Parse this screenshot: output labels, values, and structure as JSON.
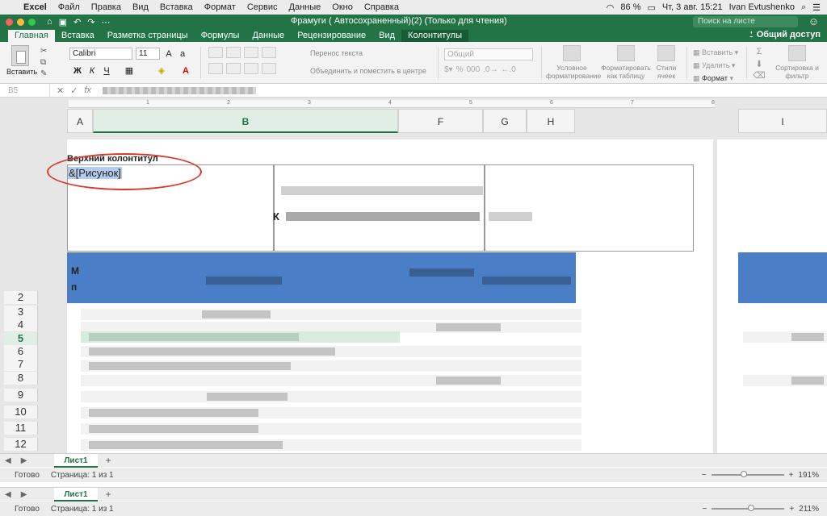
{
  "menubar": {
    "app": "Excel",
    "items": [
      "Файл",
      "Правка",
      "Вид",
      "Вставка",
      "Формат",
      "Сервис",
      "Данные",
      "Окно",
      "Справка"
    ],
    "battery": "86 %",
    "datetime": "Чт, 3 авг. 15:21",
    "user": "Ivan Evtushenko"
  },
  "window": {
    "title": "Фрамуги ( Автосохраненный)(2)  (Только для чтения)",
    "search_placeholder": "Поиск на листе",
    "share": "Общий доступ"
  },
  "ribbon_tabs": [
    {
      "label": "Главная",
      "active": true
    },
    {
      "label": "Вставка"
    },
    {
      "label": "Разметка страницы"
    },
    {
      "label": "Формулы"
    },
    {
      "label": "Данные"
    },
    {
      "label": "Рецензирование"
    },
    {
      "label": "Вид"
    },
    {
      "label": "Колонтитулы",
      "contextual": true
    }
  ],
  "ribbon": {
    "paste_label": "Вставить",
    "font_name": "Calibri",
    "font_size": "11",
    "bold": "Ж",
    "italic": "К",
    "underline": "Ч",
    "wrap_text": "Перенос текста",
    "merge_center": "Объединить и поместить в центре",
    "number_format": "Общий",
    "conditional": "Условное форматирование",
    "format_table": "Форматировать как таблицу",
    "cell_styles": "Стили ячеек",
    "insert": "Вставить",
    "delete": "Удалить",
    "format": "Формат",
    "sort_filter": "Сортировка и фильтр"
  },
  "formula_bar": {
    "name_box": "B5",
    "fx": "fx"
  },
  "columns": [
    "A",
    "B",
    "F",
    "G",
    "H",
    "I"
  ],
  "selected_column": "B",
  "header": {
    "label": "Верхний колонтитул",
    "picture_code": "&[Рисунок]",
    "center_letter": "К"
  },
  "rows": [
    "2",
    "3",
    "4",
    "5",
    "6",
    "7",
    "8",
    "9",
    "10",
    "11",
    "12"
  ],
  "selected_row": "5",
  "table_header_letters": [
    "М",
    "п"
  ],
  "sheet_tab": "Лист1",
  "status": {
    "ready": "Готово",
    "page": "Страница: 1 из 1",
    "zoom_top": "191%",
    "zoom_bottom": "211%",
    "zoom_top_fraction": 0.45,
    "zoom_bottom_fraction": 0.55
  },
  "colors": {
    "excel_green": "#227446",
    "annotation_red": "#d73b2d",
    "table_header_blue": "#4a7fc7",
    "selection_highlight": "#b4cdee"
  }
}
